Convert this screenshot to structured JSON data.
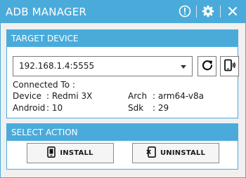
{
  "window": {
    "title": "ADB MANAGER",
    "icons": [
      "info-icon",
      "gear-icon",
      "close-icon"
    ]
  },
  "target_device": {
    "header": "TARGET DEVICE",
    "selected_device": "192.168.1.4:5555",
    "buttons": [
      "refresh-icon",
      "wireless-connect-icon"
    ],
    "connected_label": "Connected To :",
    "details": {
      "device_label": "Device",
      "device_value": ": Redmi 3X",
      "android_label": "Android",
      "android_value": ": 10",
      "arch_label": "Arch",
      "arch_value": ": arm64-v8a",
      "sdk_label": "Sdk",
      "sdk_value": ": 29"
    }
  },
  "select_action": {
    "header": "SELECT ACTION",
    "install_label": "INSTALL",
    "uninstall_label": "UNINSTALL"
  },
  "colors": {
    "accent": "#4aabdb",
    "background": "#f0f0f0",
    "panel": "#ffffff"
  }
}
